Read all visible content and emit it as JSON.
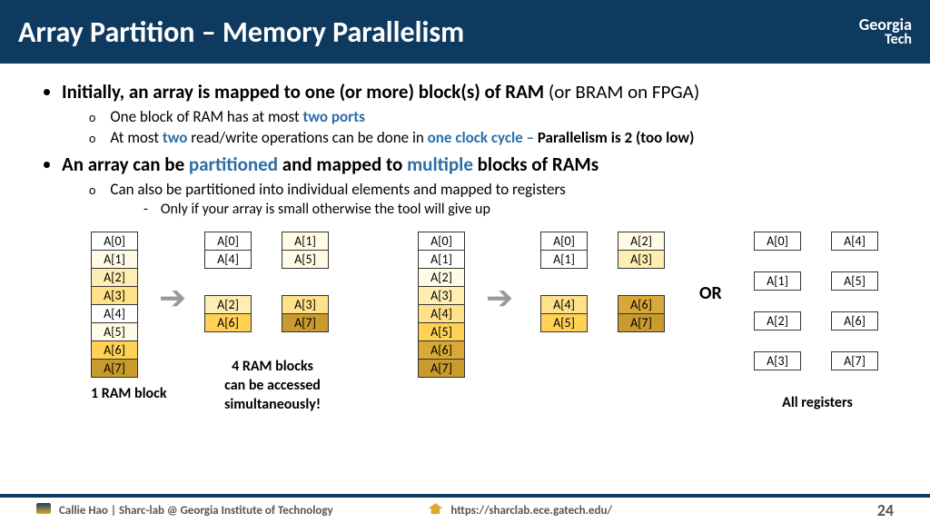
{
  "header": {
    "title": "Array Partition – Memory Parallelism",
    "logo_l1": "Georgia",
    "logo_l2": "Tech"
  },
  "bullets": {
    "p1a": "Initially, an array is mapped to one (or more) block(s) of RAM ",
    "p1b": "(or BRAM on FPGA)",
    "p1s1a": "One block of RAM has at most ",
    "p1s1b": "two ports",
    "p1s2a": "At most ",
    "p1s2b": "two",
    "p1s2c": " read/write operations can be done in ",
    "p1s2d": "one clock cycle – ",
    "p1s2e": "Parallelism is 2 (too low)",
    "p2a": "An array can be ",
    "p2b": "partitioned",
    "p2c": " and mapped to ",
    "p2d": "multiple",
    "p2e": " blocks of RAMs",
    "p2s1": "Can also be partitioned into individual elements and mapped to registers",
    "p2s1s1": "Only if your array is small otherwise the tool will give up"
  },
  "labels": {
    "one_ram": "1 RAM block",
    "four_ram_l1": "4 RAM blocks",
    "four_ram_l2": "can be accessed",
    "four_ram_l3": "simultaneously!",
    "or": "OR",
    "all_reg": "All registers"
  },
  "cells": {
    "a0": "A[0]",
    "a1": "A[1]",
    "a2": "A[2]",
    "a3": "A[3]",
    "a4": "A[4]",
    "a5": "A[5]",
    "a6": "A[6]",
    "a7": "A[7]"
  },
  "footer": {
    "left": "Callie Hao | Sharc-lab @ Georgia Institute of Technology",
    "mid": "https://sharclab.ece.gatech.edu/",
    "page": "24"
  }
}
